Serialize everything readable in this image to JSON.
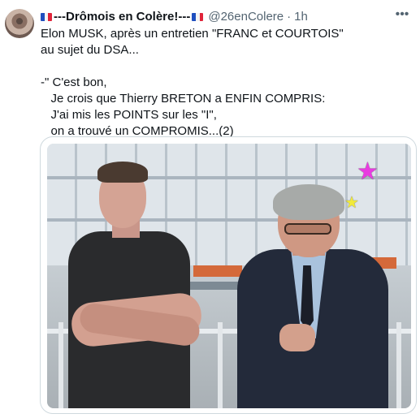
{
  "author": {
    "flag_left": "french-flag-icon",
    "display_name": "---Drômois en Colère!---",
    "flag_right": "french-flag-icon",
    "handle": "@26enColere",
    "separator": "·",
    "time": "1h"
  },
  "more_menu": "more-options-icon",
  "tweet_text": {
    "lines": [
      "Elon MUSK, après un entretien \"FRANC et COURTOIS\"",
      "au sujet du DSA...",
      "",
      "-\" C'est bon,",
      "   Je crois que Thierry BRETON a ENFIN COMPRIS:",
      "   J'ai mis les POINTS sur les \"I\",",
      "   on a trouvé un COMPROMIS...(2)"
    ]
  },
  "media": {
    "stickers": [
      "pink-star-icon",
      "yellow-star-icon"
    ]
  },
  "colors": {
    "text_primary": "#0f1419",
    "text_secondary": "#536471",
    "border": "#cfd9de",
    "star_pink": "#e83ce0",
    "star_yellow": "#f1ea3a"
  }
}
